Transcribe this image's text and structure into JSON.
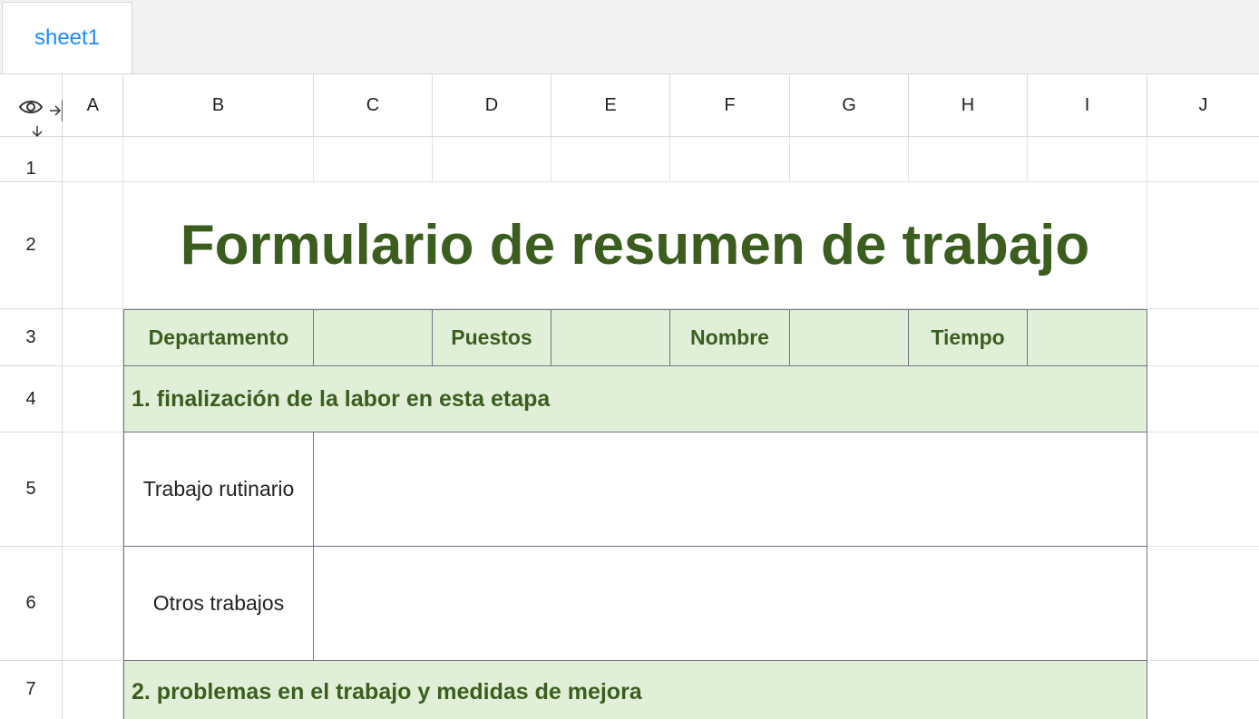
{
  "tabs": [
    {
      "label": "sheet1",
      "active": true
    }
  ],
  "columns": [
    "A",
    "B",
    "C",
    "D",
    "E",
    "F",
    "G",
    "H",
    "I",
    "J"
  ],
  "rows": [
    "1",
    "2",
    "3",
    "4",
    "5",
    "6",
    "7"
  ],
  "sheet": {
    "title": "Formulario de resumen de trabajo",
    "header_row": {
      "departamento": "Departamento",
      "puestos": "Puestos",
      "nombre": "Nombre",
      "tiempo": "Tiempo"
    },
    "section1": "1. finalización de la labor en esta etapa",
    "routine_work": "Trabajo rutinario",
    "other_work": "Otros trabajos",
    "section2": "2. problemas en el trabajo y medidas de mejora"
  },
  "colors": {
    "accent_text": "#3b5e1f",
    "header_fill": "#e1efd8",
    "tab_text": "#1a8cff",
    "border": "#6e7486"
  }
}
